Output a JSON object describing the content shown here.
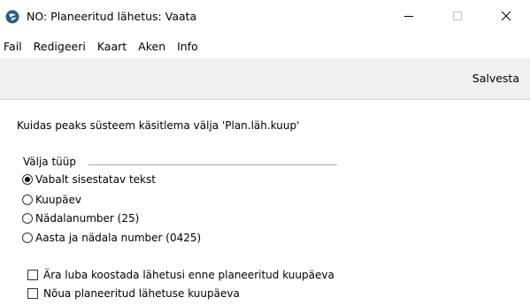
{
  "window": {
    "title": "NO: Planeeritud lähetus: Vaata",
    "icon": "app-logo-icon",
    "buttons": {
      "minimize": "minimize-icon",
      "maximize": "maximize-icon",
      "close": "close-icon"
    }
  },
  "menubar": {
    "items": [
      {
        "label": "Fail"
      },
      {
        "label": "Redigeeri"
      },
      {
        "label": "Kaart"
      },
      {
        "label": "Aken"
      },
      {
        "label": "Info"
      }
    ]
  },
  "toolbar": {
    "save_label": "Salvesta"
  },
  "dialog": {
    "question": "Kuidas peaks süsteem käsitlema välja 'Plan.läh.kuup'",
    "field_type_group": {
      "label": "Välja tüüp",
      "options": [
        {
          "label": "Vabalt sisestatav tekst",
          "selected": true
        },
        {
          "label": "Kuupäev",
          "selected": false
        },
        {
          "label": "Nädalanumber (25)",
          "selected": false
        },
        {
          "label": "Aasta ja nädala number (0425)",
          "selected": false
        }
      ]
    },
    "checkboxes": [
      {
        "label": "Ära luba koostada lähetusi enne planeeritud kuupäeva",
        "checked": false
      },
      {
        "label": "Nõua planeeritud lähetuse kuupäeva",
        "checked": false
      }
    ]
  }
}
